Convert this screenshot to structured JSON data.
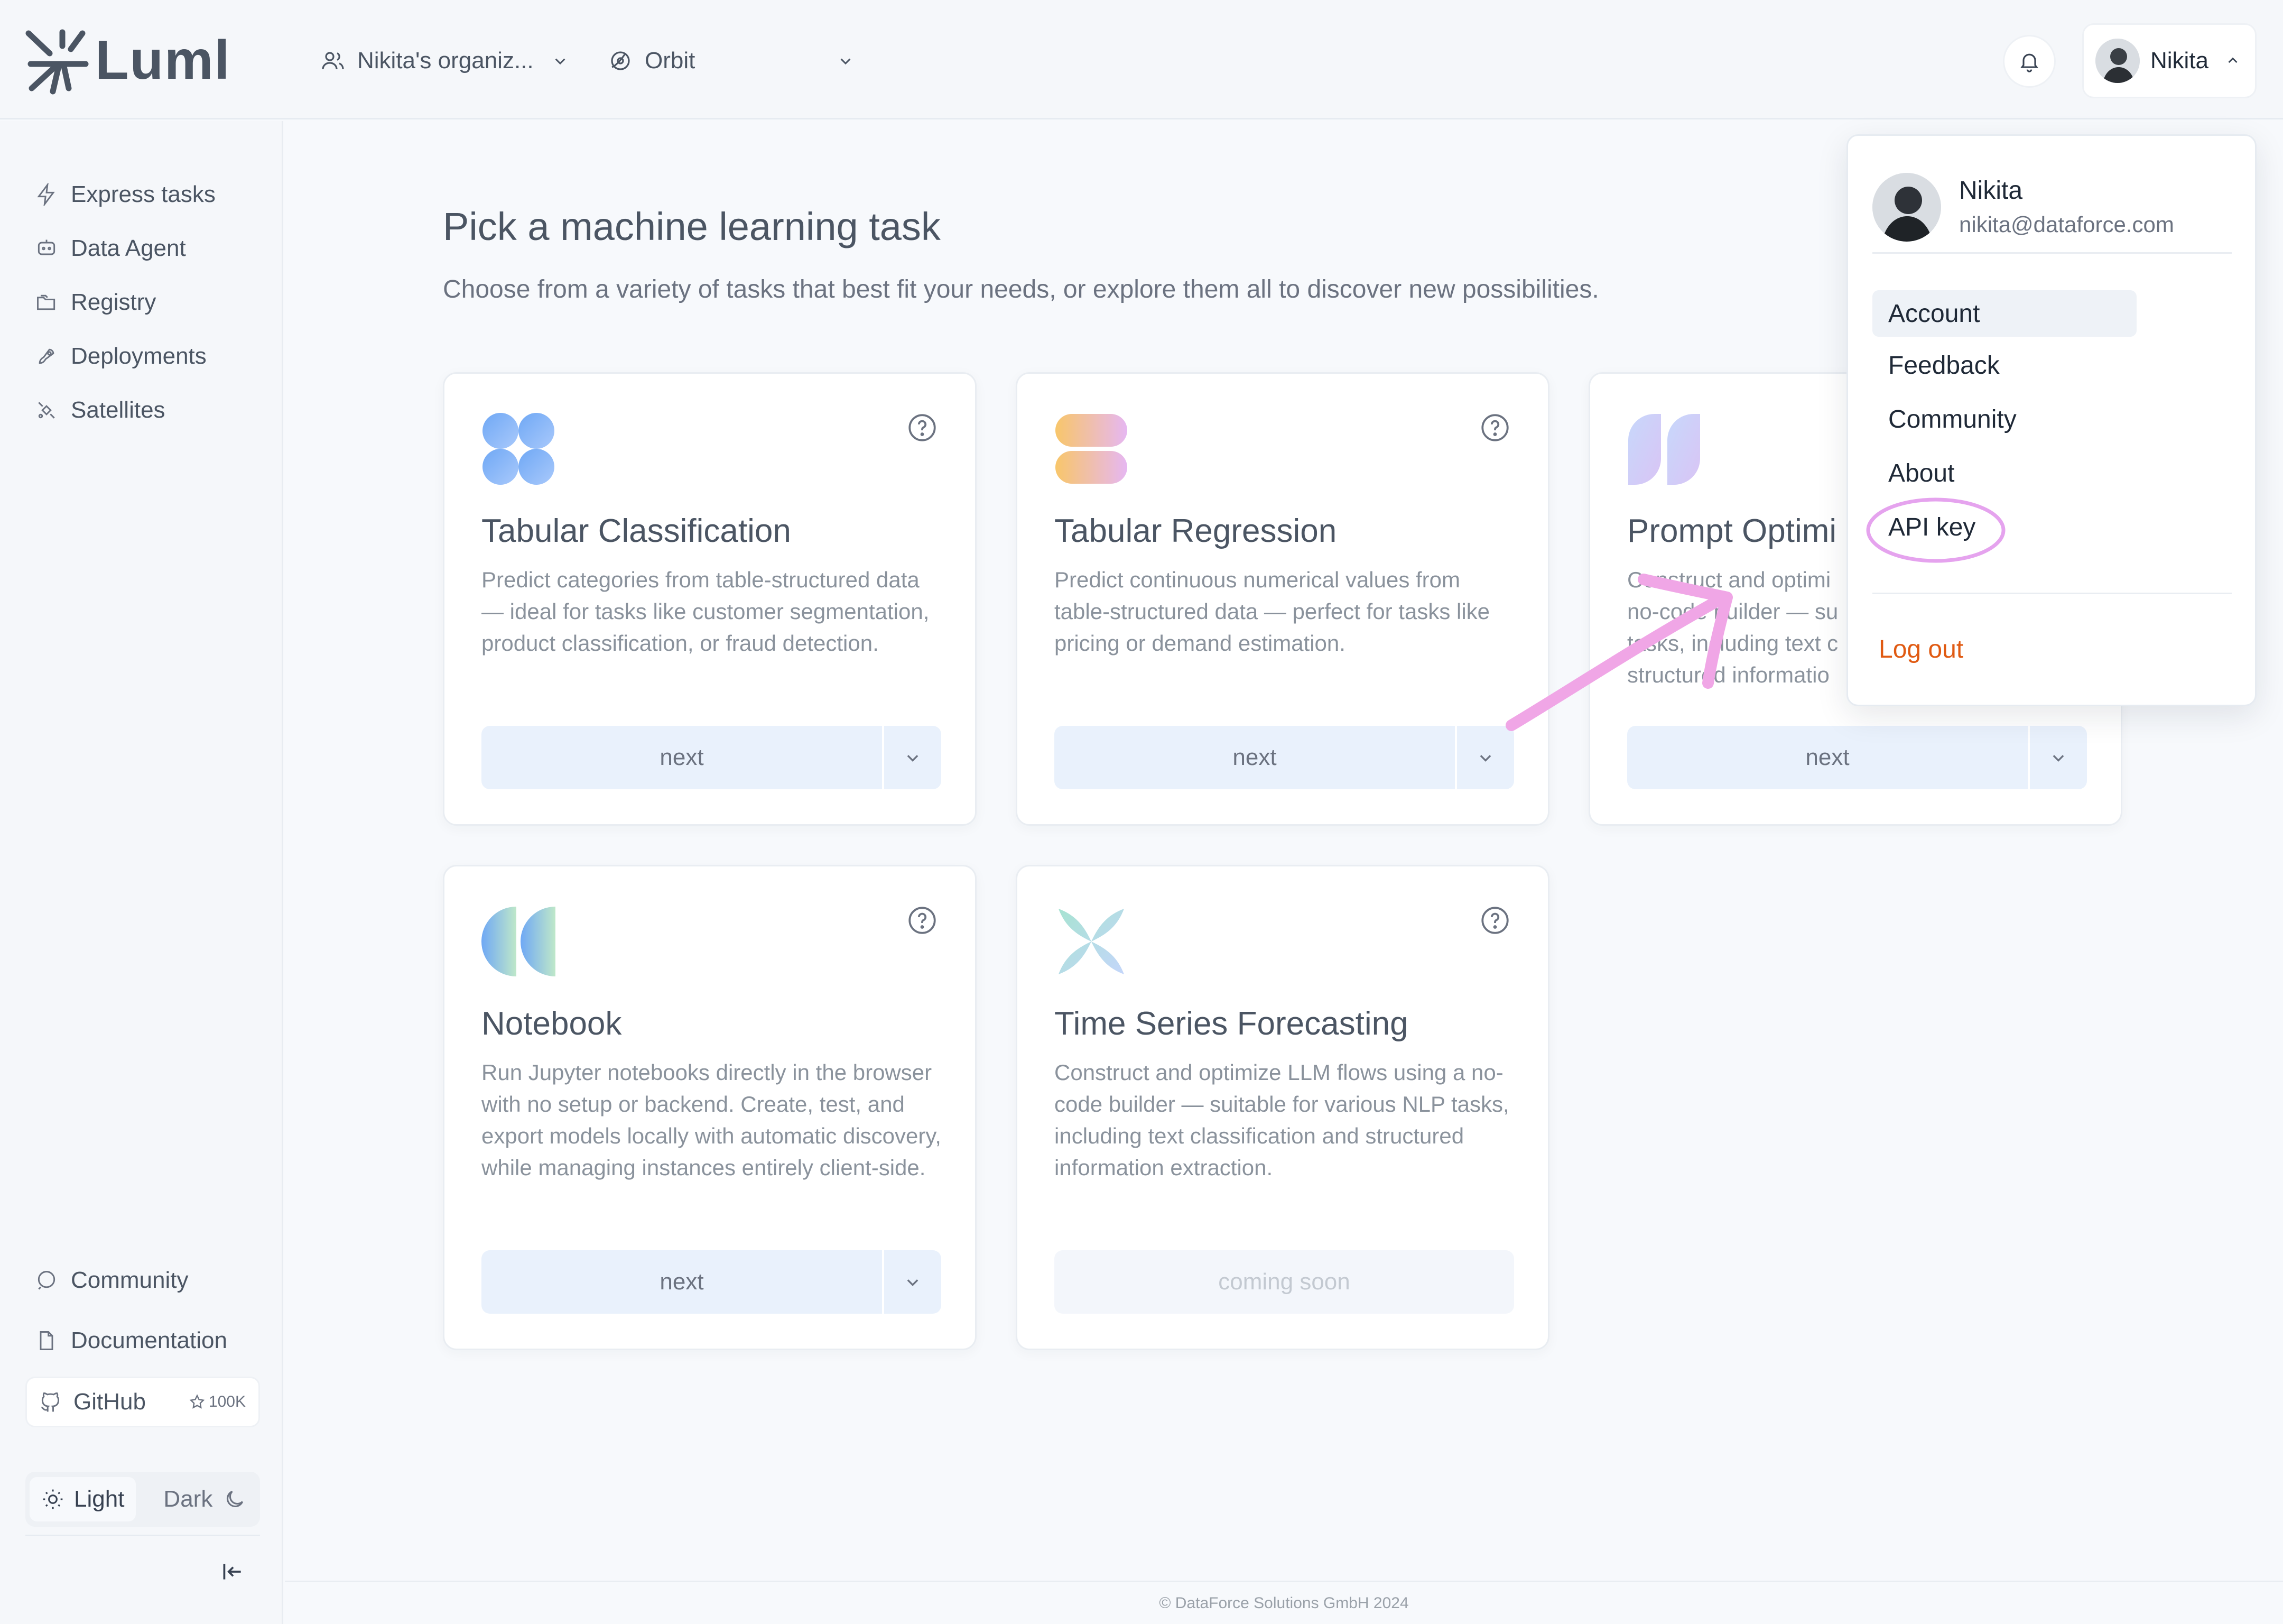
{
  "brand": {
    "name": "Luml"
  },
  "header": {
    "organization": "Nikita's organiz...",
    "orbit": "Orbit",
    "user_name": "Nikita"
  },
  "sidebar": {
    "items": [
      {
        "label": "Express tasks",
        "icon": "bolt-icon"
      },
      {
        "label": "Data Agent",
        "icon": "chat-bot-icon"
      },
      {
        "label": "Registry",
        "icon": "folders-icon"
      },
      {
        "label": "Deployments",
        "icon": "rocket-icon"
      },
      {
        "label": "Satellites",
        "icon": "satellite-icon"
      }
    ],
    "bottom": {
      "community": "Community",
      "documentation": "Documentation",
      "github": "GitHub",
      "github_stars": "100K",
      "theme_light": "Light",
      "theme_dark": "Dark"
    }
  },
  "main": {
    "title": "Pick a machine learning task",
    "subtitle": "Choose from a variety of tasks that best fit your needs, or explore them all to discover new possibilities.",
    "cards": [
      {
        "title": "Tabular Classification",
        "description": "Predict categories from table-structured data — ideal for tasks like customer segmentation, product classification, or fraud detection.",
        "button": "next"
      },
      {
        "title": "Tabular Regression",
        "description": "Predict continuous numerical values from table-structured data — perfect for tasks like pricing or demand estimation.",
        "button": "next"
      },
      {
        "title": "Prompt Optimi",
        "description": "Construct and optimi no-code builder — su tasks, including text c structured informatio",
        "button": "next"
      },
      {
        "title": "Notebook",
        "description": "Run Jupyter notebooks directly in the browser with no setup or backend. Create, test, and export models locally with automatic discovery, while managing instances entirely client-side.",
        "button": "next"
      },
      {
        "title": "Time Series Forecasting",
        "description": "Construct and optimize LLM flows using a no-code builder — suitable for various NLP tasks, including text classification and structured information extraction.",
        "button": "coming soon"
      }
    ]
  },
  "footer": {
    "text": "© DataForce Solutions GmbH 2024"
  },
  "user_menu": {
    "name": "Nikita",
    "email": "nikita@dataforce.com",
    "items": [
      "Account",
      "Feedback",
      "Community",
      "About",
      "API key"
    ],
    "logout": "Log out"
  },
  "colors": {
    "accent_bg": "#e9f1fc",
    "logout": "#e05a12",
    "annotation": "#f0a6e6"
  }
}
